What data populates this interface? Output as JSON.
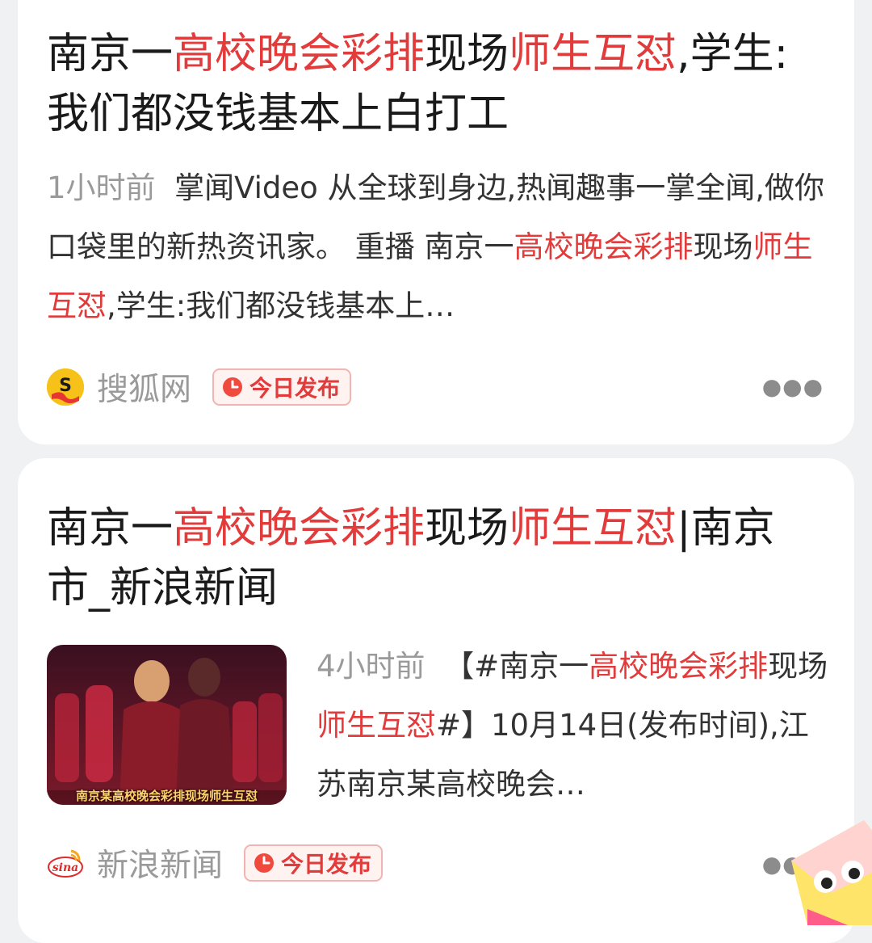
{
  "results": [
    {
      "title": {
        "p1": "南京一",
        "h1": "高校晚会彩排",
        "p2": "现场",
        "h2": "师生互怼",
        "p3": ",学生:我们都没钱基本上白打工"
      },
      "time": "1小时前",
      "snippet": {
        "t1": "掌闻Video 从全球到身边,热闻趣事一掌全闻,做你口袋里的新热资讯家。 重播 南京一",
        "h1": "高校晚会彩排",
        "t2": "现场",
        "h2": "师生互怼",
        "t3": ",学生:我们都没钱基本上…"
      },
      "source": "搜狐网",
      "logo_icon": "sohu-logo-icon",
      "badge": "今日发布",
      "more_icon": "more-dots-icon"
    },
    {
      "title": {
        "p1": "南京一",
        "h1": "高校晚会彩排",
        "p2": "现场",
        "h2": "师生互怼",
        "p3": "|南京市_新浪新闻"
      },
      "time": "4小时前",
      "snippet": {
        "t1": "【#南京一",
        "h1": "高校晚会彩排",
        "t2": "现场",
        "h2": "师生互怼",
        "t3": "#】10月14日(发布时间),江苏南京某高校晚会…"
      },
      "thumbnail_caption": "南京某高校晚会彩排现场师生互怼",
      "source": "新浪新闻",
      "logo_icon": "sina-logo-icon",
      "badge": "今日发布",
      "more_icon": "more-dots-icon"
    }
  ],
  "colors": {
    "highlight": "#e23b3b",
    "meta_gray": "#9a9a9a",
    "badge_bg": "#fff3f1",
    "badge_border": "#f2b4b0"
  }
}
